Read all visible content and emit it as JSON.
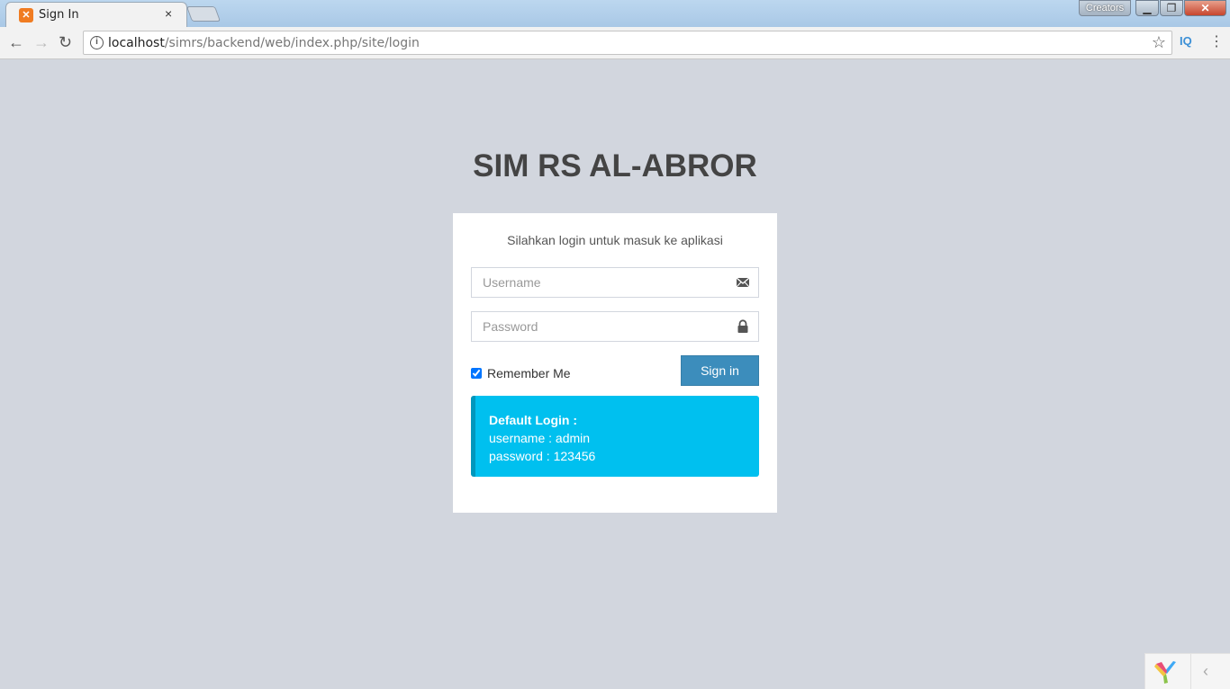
{
  "browser": {
    "tab_title": "Sign In",
    "tab_close": "×",
    "creators_label": "Creators",
    "url_host": "localhost",
    "url_path": "/simrs/backend/web/index.php/site/login",
    "extension_label": "IQ"
  },
  "page": {
    "app_title": "SIM RS AL-ABROR",
    "login_message": "Silahkan login untuk masuk ke aplikasi",
    "username_placeholder": "Username",
    "password_placeholder": "Password",
    "remember_label": "Remember Me",
    "remember_checked": true,
    "signin_label": "Sign in",
    "info": {
      "title": "Default Login :",
      "username_line": "username : admin",
      "password_line": "password : 123456"
    }
  },
  "colors": {
    "page_background": "#d2d6de",
    "primary_button": "#3c8dbc",
    "info_callout": "#00c0ef"
  }
}
